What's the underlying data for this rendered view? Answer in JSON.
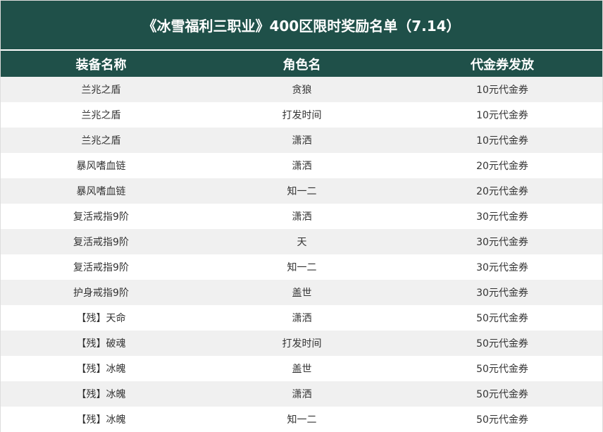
{
  "title": "《冰雪福利三职业》400区限时奖励名单（7.14）",
  "columns": [
    "装备名称",
    "角色名",
    "代金券发放"
  ],
  "rows": [
    [
      "兰兆之盾",
      "贪狼",
      "10元代金券"
    ],
    [
      "兰兆之盾",
      "打发时间",
      "10元代金券"
    ],
    [
      "兰兆之盾",
      "潇洒",
      "10元代金券"
    ],
    [
      "暴风嗜血链",
      "潇洒",
      "20元代金券"
    ],
    [
      "暴风嗜血链",
      "知一二",
      "20元代金券"
    ],
    [
      "复活戒指9阶",
      "潇洒",
      "30元代金券"
    ],
    [
      "复活戒指9阶",
      "天",
      "30元代金券"
    ],
    [
      "复活戒指9阶",
      "知一二",
      "30元代金券"
    ],
    [
      "护身戒指9阶",
      "盖世",
      "30元代金券"
    ],
    [
      "【残】天命",
      "潇洒",
      "50元代金券"
    ],
    [
      "【残】破魂",
      "打发时间",
      "50元代金券"
    ],
    [
      "【残】冰魄",
      "盖世",
      "50元代金券"
    ],
    [
      "【残】冰魄",
      "潇洒",
      "50元代金券"
    ],
    [
      "【残】冰魄",
      "知一二",
      "50元代金券"
    ]
  ],
  "colors": {
    "header_bg": "#1f5049",
    "row_alt_bg": "#f0f0f0",
    "text": "#333333"
  }
}
